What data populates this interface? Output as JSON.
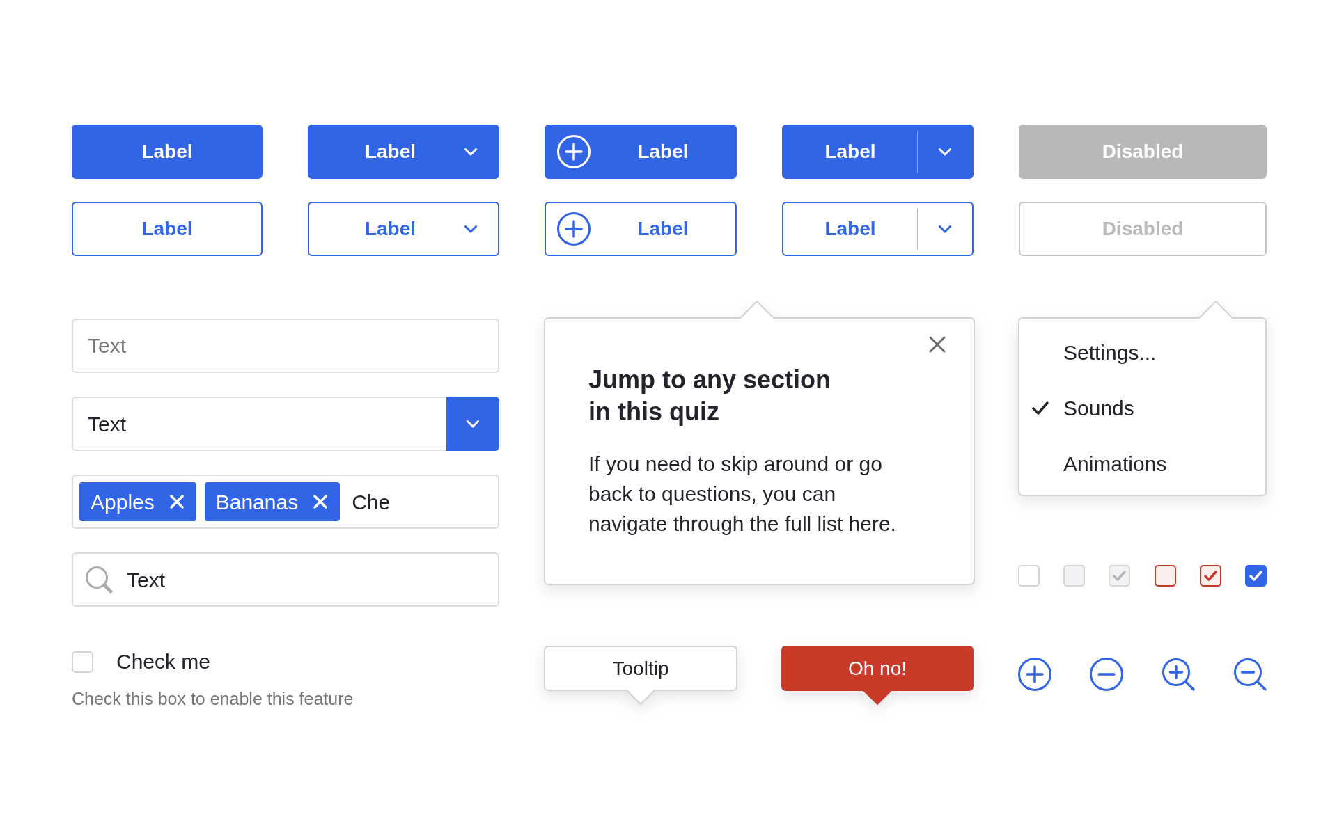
{
  "buttons": [
    {
      "kind": "plain",
      "label": "Label",
      "disabled": false
    },
    {
      "kind": "dropdown",
      "label": "Label",
      "disabled": false
    },
    {
      "kind": "icon",
      "label": "Label",
      "disabled": false
    },
    {
      "kind": "split",
      "label": "Label",
      "disabled": false
    },
    {
      "kind": "plain",
      "label": "Disabled",
      "disabled": true
    },
    {
      "kind": "plain",
      "label": "Label",
      "disabled": false
    },
    {
      "kind": "dropdown",
      "label": "Label",
      "disabled": false
    },
    {
      "kind": "icon",
      "label": "Label",
      "disabled": false
    },
    {
      "kind": "split",
      "label": "Label",
      "disabled": false
    },
    {
      "kind": "plain",
      "label": "Disabled",
      "disabled": true
    }
  ],
  "text_field": {
    "placeholder": "Text"
  },
  "select": {
    "value": "Text"
  },
  "tag_input": {
    "tags": [
      {
        "label": "Apples"
      },
      {
        "label": "Bananas"
      }
    ],
    "value": "Che"
  },
  "search_field": {
    "value": "Text"
  },
  "checkbox_field": {
    "label": "Check me",
    "checked": false,
    "helper": "Check this box to enable this feature"
  },
  "popover": {
    "title": "Jump to any section in this quiz",
    "body": "If you need to skip around or go back to questions, you can navigate through the full list here."
  },
  "menu": {
    "items": [
      {
        "label": "Settings...",
        "checked": false
      },
      {
        "label": "Sounds",
        "checked": true
      },
      {
        "label": "Animations",
        "checked": false
      }
    ]
  },
  "checkboxes": [
    {
      "kind": "default",
      "checked": false
    },
    {
      "kind": "disabled",
      "checked": false
    },
    {
      "kind": "disabled",
      "checked": true
    },
    {
      "kind": "error",
      "checked": false
    },
    {
      "kind": "error",
      "checked": true
    },
    {
      "kind": "default",
      "checked": true
    }
  ],
  "tooltips": [
    {
      "kind": "neutral",
      "text": "Tooltip"
    },
    {
      "kind": "error",
      "text": "Oh no!"
    }
  ]
}
